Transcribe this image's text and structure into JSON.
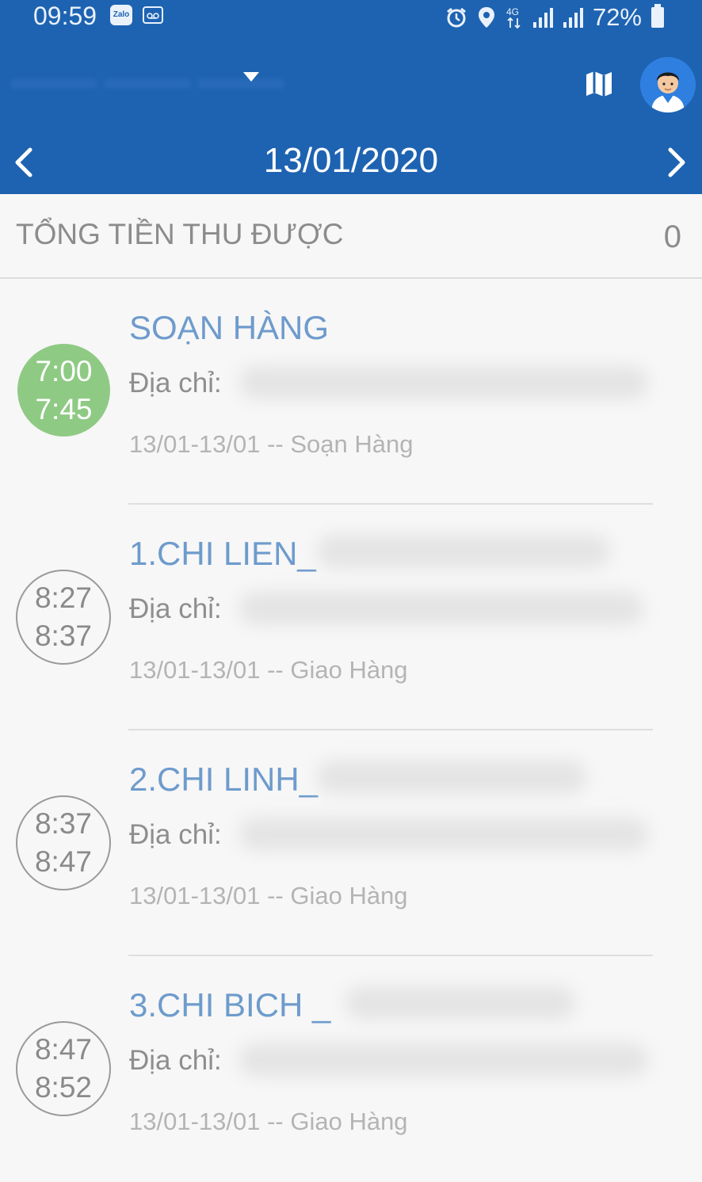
{
  "status_bar": {
    "time": "09:59",
    "notification_icons": [
      "zalo-icon",
      "voicemail-icon"
    ],
    "system_icons": [
      "alarm-icon",
      "location-icon",
      "4g-icon",
      "signal-icon",
      "signal-icon"
    ],
    "battery_percent": "72%"
  },
  "header": {
    "account_icon": "avatar",
    "date": "13/01/2020"
  },
  "summary": {
    "label": "TỔNG TIỀN THU ĐƯỢC",
    "value": "0"
  },
  "colors": {
    "primary": "#1e63b1",
    "done_badge": "#8fca84",
    "title_text": "#6e9bcc"
  },
  "items": [
    {
      "title": "SOẠN HÀNG",
      "address_label": "Địa chỉ:",
      "start": "7:00",
      "end": "7:45",
      "meta": "13/01-13/01 -- Soạn Hàng",
      "completed": true
    },
    {
      "title": "1.CHI LIEN_",
      "address_label": "Địa chỉ:",
      "start": "8:27",
      "end": "8:37",
      "meta": "13/01-13/01 -- Giao Hàng",
      "completed": false
    },
    {
      "title": "2.CHI LINH_",
      "address_label": "Địa chỉ:",
      "start": "8:37",
      "end": "8:47",
      "meta": "13/01-13/01 -- Giao Hàng",
      "completed": false
    },
    {
      "title": "3.CHI BICH _",
      "address_label": "Địa chỉ:",
      "start": "8:47",
      "end": "8:52",
      "meta": "13/01-13/01 -- Giao Hàng",
      "completed": false
    }
  ]
}
